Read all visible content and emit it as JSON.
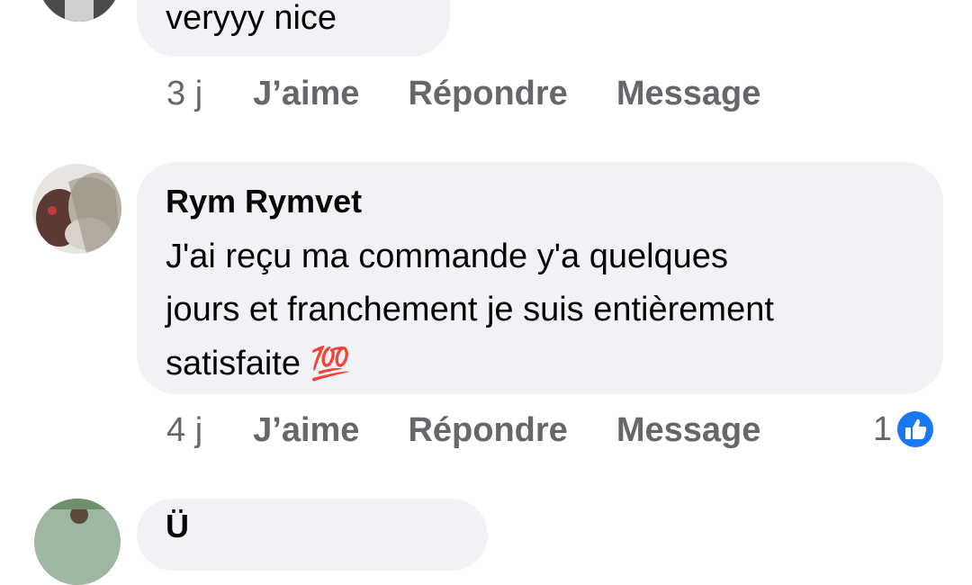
{
  "comments": [
    {
      "text": "veryyy nice",
      "actions": {
        "time": "3 j",
        "like": "J’aime",
        "reply": "Répondre",
        "message": "Message"
      }
    },
    {
      "author": "Rym Rymvet",
      "text_line1": "J'ai reçu ma commande y'a quelques",
      "text_line2": "jours et franchement je suis entièrement",
      "text_line3": "satisfaite",
      "emoji": "💯",
      "actions": {
        "time": "4 j",
        "like": "J’aime",
        "reply": "Répondre",
        "message": "Message"
      },
      "reaction_count": "1",
      "reaction_icon": "like-icon"
    },
    {
      "partial_author_char": "Ü"
    }
  ],
  "colors": {
    "bubble": "#f0f2f5",
    "meta_text": "#65676b",
    "like_blue": "#1877f2"
  }
}
